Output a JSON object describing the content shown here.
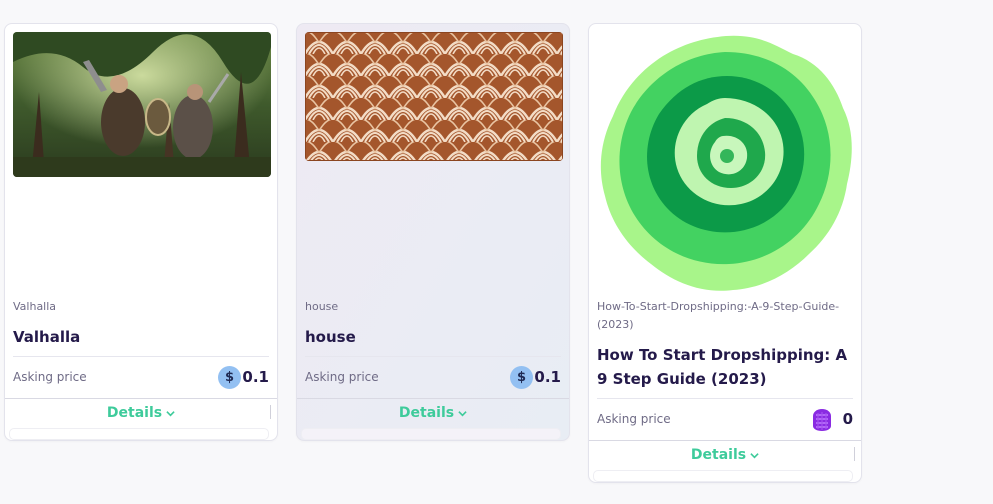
{
  "cards": [
    {
      "subtitle": "Valhalla",
      "title": "Valhalla",
      "price_label": "Asking price",
      "currency_icon": "dollar-coin-icon",
      "currency_symbol": "$",
      "price": "0.1",
      "details_label": "Details"
    },
    {
      "subtitle": "house",
      "title": "house",
      "price_label": "Asking price",
      "currency_icon": "dollar-coin-icon",
      "currency_symbol": "$",
      "price": "0.1",
      "details_label": "Details"
    },
    {
      "subtitle": "How-To-Start-Dropshipping:-A-9-Step-Guide-(2023)",
      "title": "How To Start Dropshipping: A 9 Step Guide (2023)",
      "price_label": "Asking price",
      "currency_icon": "purple-token-icon",
      "price": "0",
      "details_label": "Details"
    }
  ],
  "colors": {
    "accent": "#3ecb9b",
    "title": "#241a4a",
    "muted": "#6f6b86",
    "coin": "#93c0f2"
  }
}
